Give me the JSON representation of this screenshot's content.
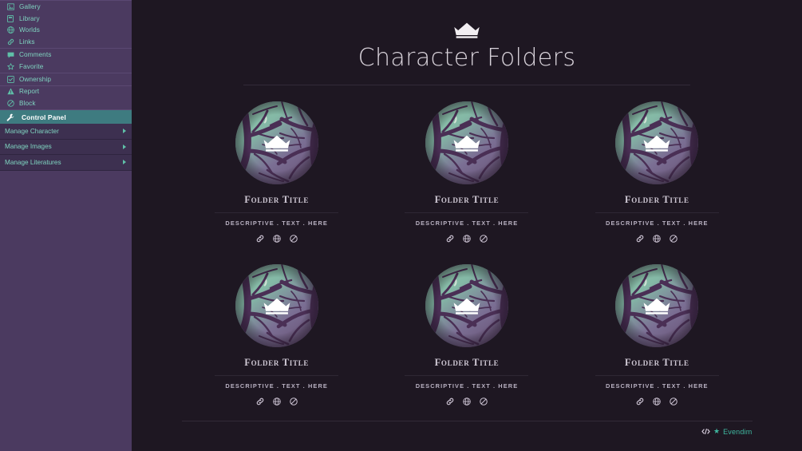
{
  "sidebar": {
    "groups": [
      {
        "items": [
          {
            "label": "Gallery",
            "icon": "image-icon"
          },
          {
            "label": "Library",
            "icon": "book-icon"
          },
          {
            "label": "Worlds",
            "icon": "globe-icon"
          },
          {
            "label": "Links",
            "icon": "link-icon"
          }
        ]
      },
      {
        "items": [
          {
            "label": "Comments",
            "icon": "comment-icon"
          },
          {
            "label": "Favorite",
            "icon": "star-icon"
          }
        ]
      },
      {
        "items": [
          {
            "label": "Ownership",
            "icon": "checkbox-icon"
          }
        ]
      },
      {
        "items": [
          {
            "label": "Report",
            "icon": "warning-icon"
          },
          {
            "label": "Block",
            "icon": "block-icon"
          }
        ]
      }
    ],
    "active_item": {
      "label": "Control Panel",
      "icon": "wrench-icon"
    },
    "manage_items": [
      {
        "label": "Manage Character",
        "arrow": "chevron-right-icon"
      },
      {
        "label": "Manage Images",
        "arrow": "chevron-right-icon"
      },
      {
        "label": "Manage Literatures",
        "arrow": "chevron-right-icon"
      }
    ]
  },
  "main": {
    "emblem": "crown-icon",
    "title": "Character Folders",
    "folders": [
      {
        "title": "Folder Title",
        "description": "Descriptive . Text . Here"
      },
      {
        "title": "Folder Title",
        "description": "Descriptive . Text . Here"
      },
      {
        "title": "Folder Title",
        "description": "Descriptive . Text . Here"
      },
      {
        "title": "Folder Title",
        "description": "Descriptive . Text . Here"
      },
      {
        "title": "Folder Title",
        "description": "Descriptive . Text . Here"
      },
      {
        "title": "Folder Title",
        "description": "Descriptive . Text . Here"
      }
    ],
    "card_actions": [
      {
        "name": "link-icon"
      },
      {
        "name": "globe-icon"
      },
      {
        "name": "block-icon"
      }
    ]
  },
  "footer": {
    "code_icon": "code-icon",
    "star_icon": "star-icon",
    "brand": "Evendim"
  },
  "colors": {
    "page_background": "#1e1722",
    "sidebar_background": "#4b3a60",
    "sidebar_manage_background": "#3d3050",
    "accent_teal": "#3fb8a0",
    "active_row": "#3e7b80",
    "nav_text": "#7fd4c0",
    "title_text": "#d8d2da"
  }
}
